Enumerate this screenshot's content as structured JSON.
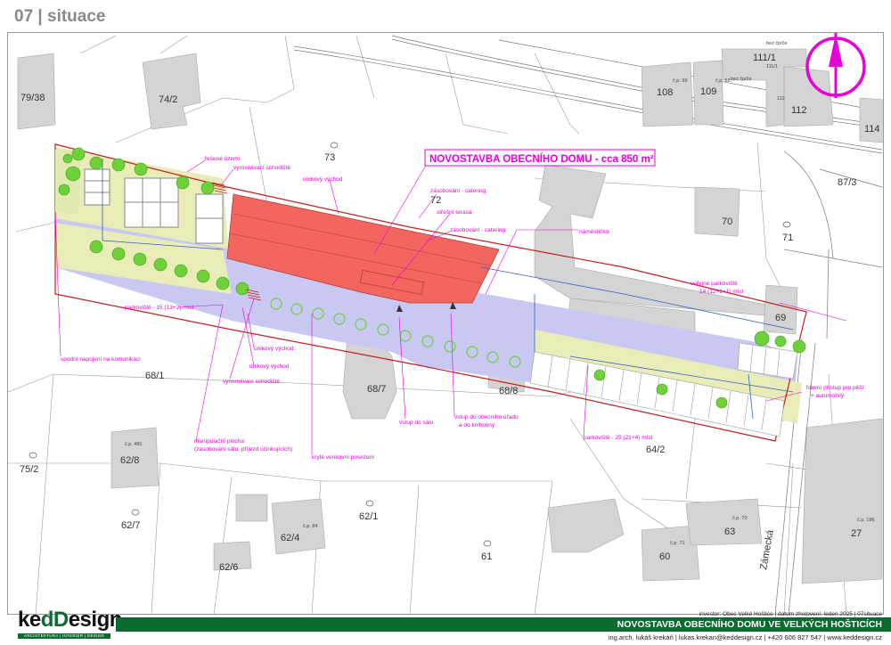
{
  "page": {
    "title": "07 | situace"
  },
  "parcels": {
    "p79_38": "79/38",
    "p74_2": "74/2",
    "p73": "73",
    "p72": "72",
    "p70": "70",
    "p71": "71",
    "p69": "69",
    "p68_1": "68/1",
    "p68_7": "68/7",
    "p68_8": "68/8",
    "p64_2": "64/2",
    "p62_8": "62/8",
    "p62_7": "62/7",
    "p62_1": "62/1",
    "p62_4": "62/4",
    "p62_6": "62/6",
    "p75_2": "75/2",
    "p61": "61",
    "p60": "60",
    "p63": "63",
    "p27": "27",
    "p108": "108",
    "p109": "109",
    "p111_1": "111/1",
    "p112": "112",
    "p114": "114",
    "p87_3": "87/3",
    "cp481": "č.p. 481",
    "cp84": "č.p. 84",
    "cp70": "č.p. 70",
    "cp71": "č.p. 71",
    "cp186": "č.p. 186",
    "cp99": "č.p. 99",
    "cp52": "č.p. 52",
    "bez_cp1": "bez čp/če",
    "bez_cp2": "bez čp/če",
    "p111_sub": "111/1",
    "p112_sub": "112"
  },
  "street": {
    "zamecka": "Zámecká"
  },
  "headline": "NOVOSTAVBA OBECNÍHO DOMU - cca 850 m²",
  "annotations": {
    "reseny_uzemi": "řešené území",
    "vyrovnavaci_top": "vyrovnávací schodiště",
    "unikovy_top": "únikový východ",
    "zasobovani_catering1": "zásobování - catering",
    "stresni_terasa": "střešní terasa",
    "zasobovani_catering2": "zásobování - catering",
    "namesticko": "náměstíčko",
    "verejne_parkoviste": "veřejné parkoviště",
    "verejne_parkoviste_count": "14 (12+1+1) míst",
    "parkoviste15": "parkoviště - 15 (13+2) míst",
    "spodni_napojeni": "spodní napojení na komunikaci",
    "unikovy_1": "únikový východ",
    "unikovy_2": "únikový východ",
    "vyrovnavaci_bottom": "vyrovnávací schodiště",
    "manipulacni_1": "manipulační plocha",
    "manipulacni_2": "(zásobování sálu, příjezd účinkujících)",
    "kryte_posezeni": "kryté venkovní posezení",
    "vstup_salu": "vstup do sálu",
    "vstup_uradu_1": "vstup do obecního úřadu",
    "vstup_uradu_2": "a do knihovny",
    "parkoviste25": "parkoviště - 25 (21+4) míst",
    "hlavni_pristup_1": "hlavní přístup pro pěší",
    "hlavni_pristup_2": "+ automobily"
  },
  "footer": {
    "logo_prefix": "ke",
    "logo_dd": "dD",
    "logo_suffix": "esign",
    "logo_tagline": "ARCHITEKTURA | INTERIÉR | DESIGN",
    "meta": "investor: Obec Velké Hoštice | datum zhotovení: leden 2025 | 07situace",
    "project": "NOVOSTAVBA OBECNÍHO DOMU VE VELKÝCH HOŠTICÍCH",
    "contact": "ing.arch. lukáš krekáň | lukas.krekan@keddesign.cz | +420 606 827 547 | www.keddesign.cz"
  },
  "colors": {
    "building": "#f2665f",
    "paved": "#c8c8f2",
    "green_area": "#e9ecb6",
    "site_boundary": "#c41f1f",
    "annotation": "#e800d8",
    "neighbour_building": "#d4d4d4",
    "tree": "#6fd13a",
    "utility_line": "#3060c8",
    "footer_green": "#0b6b2e"
  }
}
